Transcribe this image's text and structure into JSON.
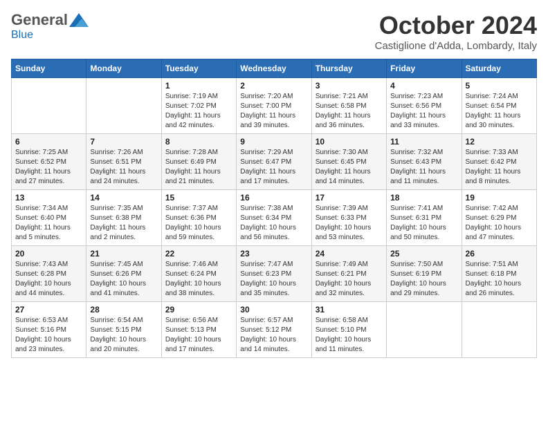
{
  "header": {
    "logo_general": "General",
    "logo_blue": "Blue",
    "month_title": "October 2024",
    "location": "Castiglione d'Adda, Lombardy, Italy"
  },
  "columns": [
    "Sunday",
    "Monday",
    "Tuesday",
    "Wednesday",
    "Thursday",
    "Friday",
    "Saturday"
  ],
  "weeks": [
    [
      {
        "day": "",
        "sunrise": "",
        "sunset": "",
        "daylight": ""
      },
      {
        "day": "",
        "sunrise": "",
        "sunset": "",
        "daylight": ""
      },
      {
        "day": "1",
        "sunrise": "Sunrise: 7:19 AM",
        "sunset": "Sunset: 7:02 PM",
        "daylight": "Daylight: 11 hours and 42 minutes."
      },
      {
        "day": "2",
        "sunrise": "Sunrise: 7:20 AM",
        "sunset": "Sunset: 7:00 PM",
        "daylight": "Daylight: 11 hours and 39 minutes."
      },
      {
        "day": "3",
        "sunrise": "Sunrise: 7:21 AM",
        "sunset": "Sunset: 6:58 PM",
        "daylight": "Daylight: 11 hours and 36 minutes."
      },
      {
        "day": "4",
        "sunrise": "Sunrise: 7:23 AM",
        "sunset": "Sunset: 6:56 PM",
        "daylight": "Daylight: 11 hours and 33 minutes."
      },
      {
        "day": "5",
        "sunrise": "Sunrise: 7:24 AM",
        "sunset": "Sunset: 6:54 PM",
        "daylight": "Daylight: 11 hours and 30 minutes."
      }
    ],
    [
      {
        "day": "6",
        "sunrise": "Sunrise: 7:25 AM",
        "sunset": "Sunset: 6:52 PM",
        "daylight": "Daylight: 11 hours and 27 minutes."
      },
      {
        "day": "7",
        "sunrise": "Sunrise: 7:26 AM",
        "sunset": "Sunset: 6:51 PM",
        "daylight": "Daylight: 11 hours and 24 minutes."
      },
      {
        "day": "8",
        "sunrise": "Sunrise: 7:28 AM",
        "sunset": "Sunset: 6:49 PM",
        "daylight": "Daylight: 11 hours and 21 minutes."
      },
      {
        "day": "9",
        "sunrise": "Sunrise: 7:29 AM",
        "sunset": "Sunset: 6:47 PM",
        "daylight": "Daylight: 11 hours and 17 minutes."
      },
      {
        "day": "10",
        "sunrise": "Sunrise: 7:30 AM",
        "sunset": "Sunset: 6:45 PM",
        "daylight": "Daylight: 11 hours and 14 minutes."
      },
      {
        "day": "11",
        "sunrise": "Sunrise: 7:32 AM",
        "sunset": "Sunset: 6:43 PM",
        "daylight": "Daylight: 11 hours and 11 minutes."
      },
      {
        "day": "12",
        "sunrise": "Sunrise: 7:33 AM",
        "sunset": "Sunset: 6:42 PM",
        "daylight": "Daylight: 11 hours and 8 minutes."
      }
    ],
    [
      {
        "day": "13",
        "sunrise": "Sunrise: 7:34 AM",
        "sunset": "Sunset: 6:40 PM",
        "daylight": "Daylight: 11 hours and 5 minutes."
      },
      {
        "day": "14",
        "sunrise": "Sunrise: 7:35 AM",
        "sunset": "Sunset: 6:38 PM",
        "daylight": "Daylight: 11 hours and 2 minutes."
      },
      {
        "day": "15",
        "sunrise": "Sunrise: 7:37 AM",
        "sunset": "Sunset: 6:36 PM",
        "daylight": "Daylight: 10 hours and 59 minutes."
      },
      {
        "day": "16",
        "sunrise": "Sunrise: 7:38 AM",
        "sunset": "Sunset: 6:34 PM",
        "daylight": "Daylight: 10 hours and 56 minutes."
      },
      {
        "day": "17",
        "sunrise": "Sunrise: 7:39 AM",
        "sunset": "Sunset: 6:33 PM",
        "daylight": "Daylight: 10 hours and 53 minutes."
      },
      {
        "day": "18",
        "sunrise": "Sunrise: 7:41 AM",
        "sunset": "Sunset: 6:31 PM",
        "daylight": "Daylight: 10 hours and 50 minutes."
      },
      {
        "day": "19",
        "sunrise": "Sunrise: 7:42 AM",
        "sunset": "Sunset: 6:29 PM",
        "daylight": "Daylight: 10 hours and 47 minutes."
      }
    ],
    [
      {
        "day": "20",
        "sunrise": "Sunrise: 7:43 AM",
        "sunset": "Sunset: 6:28 PM",
        "daylight": "Daylight: 10 hours and 44 minutes."
      },
      {
        "day": "21",
        "sunrise": "Sunrise: 7:45 AM",
        "sunset": "Sunset: 6:26 PM",
        "daylight": "Daylight: 10 hours and 41 minutes."
      },
      {
        "day": "22",
        "sunrise": "Sunrise: 7:46 AM",
        "sunset": "Sunset: 6:24 PM",
        "daylight": "Daylight: 10 hours and 38 minutes."
      },
      {
        "day": "23",
        "sunrise": "Sunrise: 7:47 AM",
        "sunset": "Sunset: 6:23 PM",
        "daylight": "Daylight: 10 hours and 35 minutes."
      },
      {
        "day": "24",
        "sunrise": "Sunrise: 7:49 AM",
        "sunset": "Sunset: 6:21 PM",
        "daylight": "Daylight: 10 hours and 32 minutes."
      },
      {
        "day": "25",
        "sunrise": "Sunrise: 7:50 AM",
        "sunset": "Sunset: 6:19 PM",
        "daylight": "Daylight: 10 hours and 29 minutes."
      },
      {
        "day": "26",
        "sunrise": "Sunrise: 7:51 AM",
        "sunset": "Sunset: 6:18 PM",
        "daylight": "Daylight: 10 hours and 26 minutes."
      }
    ],
    [
      {
        "day": "27",
        "sunrise": "Sunrise: 6:53 AM",
        "sunset": "Sunset: 5:16 PM",
        "daylight": "Daylight: 10 hours and 23 minutes."
      },
      {
        "day": "28",
        "sunrise": "Sunrise: 6:54 AM",
        "sunset": "Sunset: 5:15 PM",
        "daylight": "Daylight: 10 hours and 20 minutes."
      },
      {
        "day": "29",
        "sunrise": "Sunrise: 6:56 AM",
        "sunset": "Sunset: 5:13 PM",
        "daylight": "Daylight: 10 hours and 17 minutes."
      },
      {
        "day": "30",
        "sunrise": "Sunrise: 6:57 AM",
        "sunset": "Sunset: 5:12 PM",
        "daylight": "Daylight: 10 hours and 14 minutes."
      },
      {
        "day": "31",
        "sunrise": "Sunrise: 6:58 AM",
        "sunset": "Sunset: 5:10 PM",
        "daylight": "Daylight: 10 hours and 11 minutes."
      },
      {
        "day": "",
        "sunrise": "",
        "sunset": "",
        "daylight": ""
      },
      {
        "day": "",
        "sunrise": "",
        "sunset": "",
        "daylight": ""
      }
    ]
  ]
}
